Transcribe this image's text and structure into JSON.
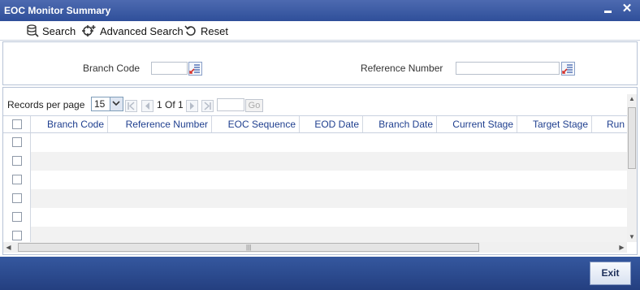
{
  "window": {
    "title": "EOC Monitor Summary"
  },
  "toolbar": {
    "search_label": "Search",
    "advanced_search_label": "Advanced Search",
    "reset_label": "Reset"
  },
  "criteria": {
    "branch_code_label": "Branch Code",
    "reference_number_label": "Reference Number",
    "branch_code_value": "",
    "reference_number_value": ""
  },
  "pager": {
    "records_per_page_label": "Records per page",
    "records_per_page_value": "15",
    "page_info": "1 Of 1",
    "go_label": "Go"
  },
  "grid": {
    "columns": [
      "Branch Code",
      "Reference Number",
      "EOC Sequence",
      "EOD Date",
      "Branch Date",
      "Current Stage",
      "Target Stage",
      "Run"
    ],
    "row_count_visible": 6
  },
  "footer": {
    "exit_label": "Exit"
  },
  "colors": {
    "title_bar": "#2f4f9a",
    "header_text": "#1f3f8f",
    "footer": "#243f80"
  }
}
